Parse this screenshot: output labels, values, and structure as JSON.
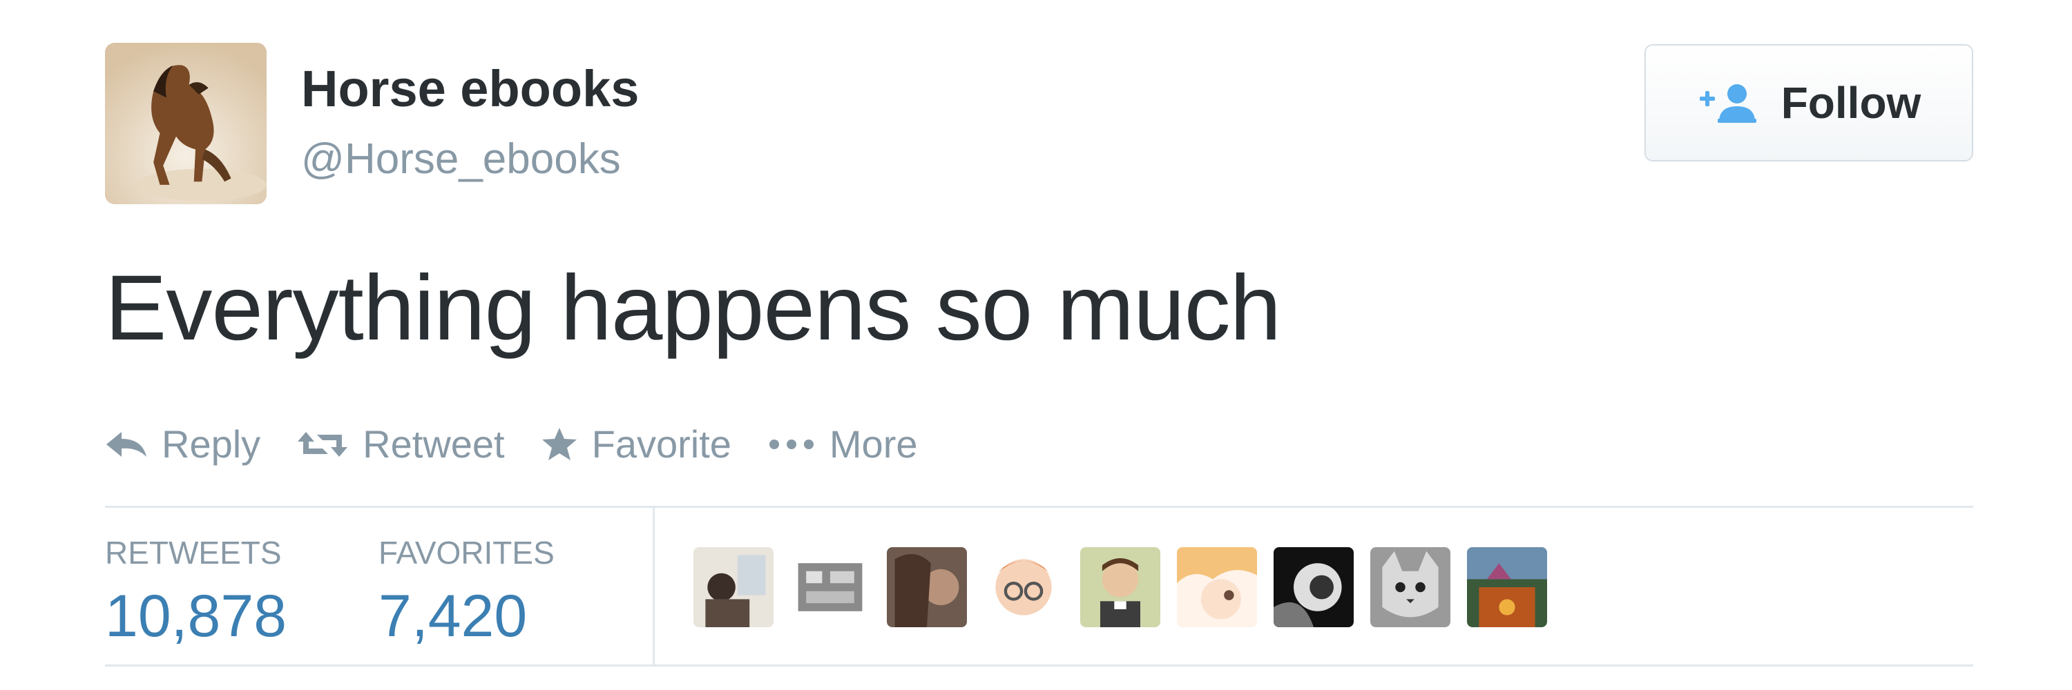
{
  "user": {
    "name": "Horse ebooks",
    "handle": "@Horse_ebooks"
  },
  "follow_button": {
    "label": "Follow",
    "icon": "add-user-icon"
  },
  "tweet": {
    "text": "Everything happens so much"
  },
  "actions": [
    {
      "label": "Reply",
      "icon": "reply-icon"
    },
    {
      "label": "Retweet",
      "icon": "retweet-icon"
    },
    {
      "label": "Favorite",
      "icon": "star-icon"
    },
    {
      "label": "More",
      "icon": "more-dots-icon"
    }
  ],
  "stats": {
    "retweets": {
      "label": "RETWEETS",
      "value": "10,878"
    },
    "favorites": {
      "label": "FAVORITES",
      "value": "7,420"
    }
  },
  "favoriters": {
    "count_shown": 9
  },
  "colors": {
    "text": "#292f33",
    "muted": "#8899a6",
    "link": "#3b7fb3",
    "follow_icon": "#55acee",
    "border": "#e1e8ed"
  }
}
